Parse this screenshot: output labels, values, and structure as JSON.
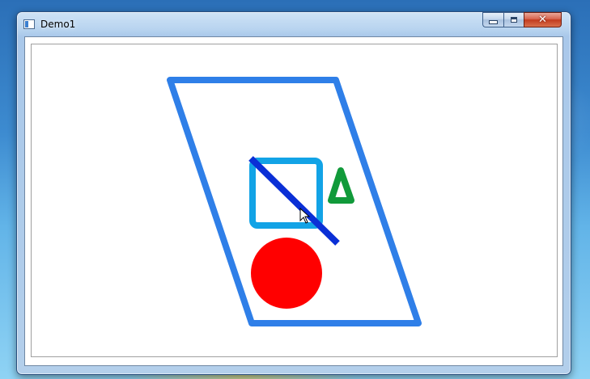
{
  "window": {
    "title": "Demo1",
    "minimize_symbol": "",
    "close_symbol": "✕"
  },
  "icons": {
    "app": "app-icon",
    "minimize": "minimize-icon",
    "maximize": "maximize-icon",
    "close": "close-icon",
    "cursor": "mouse-pointer-icon"
  },
  "colors": {
    "parallelogram": "#2f7fe8",
    "square": "#12a3e6",
    "line": "#0a2fd6",
    "triangle": "#119a3a",
    "circle": "#ff0000"
  },
  "shapes": [
    "parallelogram",
    "square",
    "diagonal-line",
    "triangle",
    "circle"
  ]
}
